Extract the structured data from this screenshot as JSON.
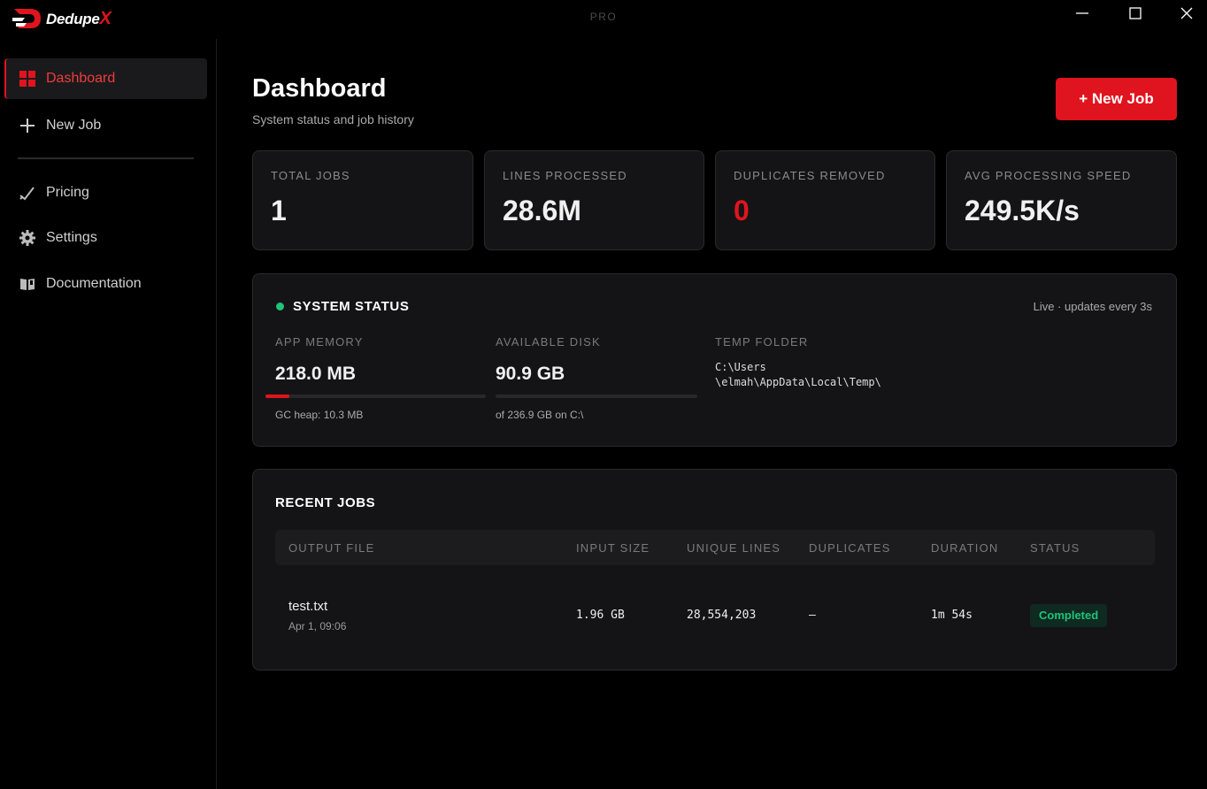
{
  "app": {
    "name_main": "Dedupe",
    "name_accent": "X",
    "edition": "PRO"
  },
  "sidebar": {
    "items": [
      {
        "label": "Dashboard",
        "icon": "grid-icon"
      },
      {
        "label": "New Job",
        "icon": "plus-icon"
      },
      {
        "label": "Pricing",
        "icon": "trend-icon"
      },
      {
        "label": "Settings",
        "icon": "gear-icon"
      },
      {
        "label": "Documentation",
        "icon": "book-icon"
      }
    ],
    "active": "Dashboard"
  },
  "header": {
    "title": "Dashboard",
    "subtitle": "System status and job history",
    "new_job_label": "+ New Job"
  },
  "stats": [
    {
      "label": "TOTAL JOBS",
      "value": "1"
    },
    {
      "label": "LINES PROCESSED",
      "value": "28.6M"
    },
    {
      "label": "DUPLICATES REMOVED",
      "value": "0"
    },
    {
      "label": "AVG PROCESSING SPEED",
      "value": "249.5K/s"
    }
  ],
  "system_status": {
    "title": "SYSTEM STATUS",
    "live_text": "Live · updates every 3s",
    "memory": {
      "label": "APP MEMORY",
      "value": "218.0 MB",
      "sub": "GC heap: 10.3 MB",
      "usage_fraction": 0.11
    },
    "disk": {
      "label": "AVAILABLE DISK",
      "value": "90.9 GB",
      "sub": "of 236.9 GB on C:\\"
    },
    "temp": {
      "label": "TEMP FOLDER",
      "line1": "C:\\Users",
      "line2": "\\elmah\\AppData\\Local\\Temp\\"
    }
  },
  "recent_jobs": {
    "title": "RECENT JOBS",
    "columns": [
      "OUTPUT FILE",
      "INPUT SIZE",
      "UNIQUE LINES",
      "DUPLICATES",
      "DURATION",
      "STATUS"
    ],
    "rows": [
      {
        "file": "test.txt",
        "date": "Apr 1, 09:06",
        "input_size": "1.96 GB",
        "unique_lines": "28,554,203",
        "duplicates": "—",
        "duration": "1m 54s",
        "status": "Completed"
      }
    ]
  },
  "colors": {
    "accent": "#e0141e",
    "success": "#1fc37a",
    "background": "#000000",
    "card": "#141416"
  }
}
